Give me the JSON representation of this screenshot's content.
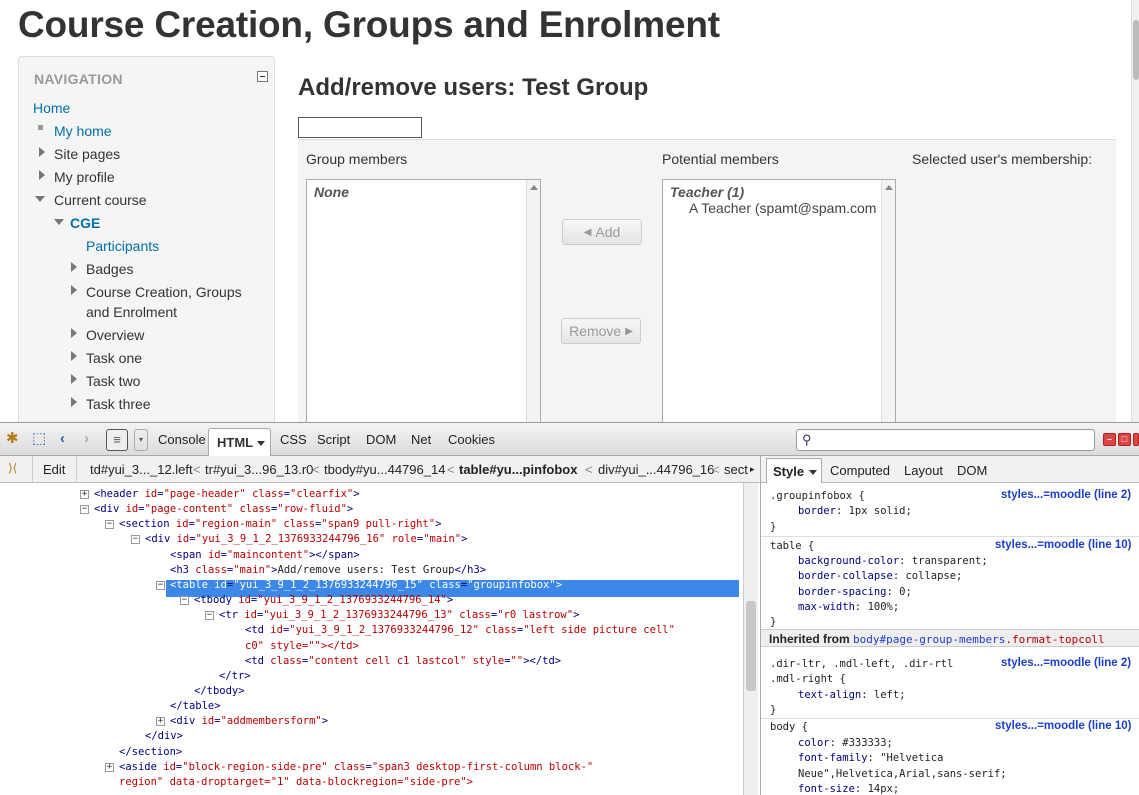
{
  "page": {
    "title": "Course Creation, Groups and Enrolment"
  },
  "navigation": {
    "heading": "NAVIGATION",
    "items": [
      {
        "label": "Home"
      },
      {
        "label": "My home"
      },
      {
        "label": "Site pages"
      },
      {
        "label": "My profile"
      },
      {
        "label": "Current course"
      },
      {
        "label": "CGE"
      },
      {
        "label": "Participants"
      },
      {
        "label": "Badges"
      },
      {
        "label": "Course Creation, Groups"
      },
      {
        "label": "and Enrolment"
      },
      {
        "label": "Overview"
      },
      {
        "label": "Task one"
      },
      {
        "label": "Task two"
      },
      {
        "label": "Task three"
      }
    ]
  },
  "main": {
    "heading": "Add/remove users: Test Group",
    "group_members_label": "Group members",
    "group_members_none": "None",
    "potential_members_label": "Potential members",
    "potential_group": "Teacher (1)",
    "potential_user": "A Teacher (spamt@spam.com",
    "membership_label": "Selected user's membership:",
    "add_label": "Add",
    "remove_label": "Remove",
    "add_icon": "◀",
    "remove_icon": "▶"
  },
  "firebug": {
    "tabs": [
      "Console",
      "HTML",
      "CSS",
      "Script",
      "DOM",
      "Net",
      "Cookies"
    ],
    "edit_label": "Edit",
    "breadcrumbs": [
      "td#yui_3..._12.left",
      "tr#yui_3...96_13.r0",
      "tbody#yu...44796_14",
      "table#yu...pinfobox",
      "div#yui_...44796_16",
      "sect"
    ],
    "side_tabs": [
      "Style",
      "Computed",
      "Layout",
      "DOM"
    ],
    "tree": [
      {
        "t": "<header ",
        "a": [
          [
            "id",
            "page-header"
          ],
          [
            "class",
            "clearfix"
          ]
        ],
        "e": ">"
      },
      {
        "t": "<div ",
        "a": [
          [
            "id",
            "page-content"
          ],
          [
            "class",
            "row-fluid"
          ]
        ],
        "e": ">"
      },
      {
        "t": "<section ",
        "a": [
          [
            "id",
            "region-main"
          ],
          [
            "class",
            "span9 pull-right"
          ]
        ],
        "e": ">"
      },
      {
        "t": "<div ",
        "a": [
          [
            "id",
            "yui_3_9_1_2_1376933244796_16"
          ],
          [
            "role",
            "main"
          ]
        ],
        "e": ">"
      },
      {
        "t": "<span ",
        "a": [
          [
            "id",
            "maincontent"
          ]
        ],
        "e": "></span>"
      },
      {
        "t": "<h3 ",
        "a": [
          [
            "class",
            "main"
          ]
        ],
        "e": ">",
        "x": "Add/remove users: Test Group",
        "c": "</h3>"
      },
      {
        "t": "<table ",
        "a": [
          [
            "id",
            "yui_3_9_1_2_1376933244796_15"
          ],
          [
            "class",
            "groupinfobox"
          ]
        ],
        "e": ">"
      },
      {
        "t": "<tbody ",
        "a": [
          [
            "id",
            "yui_3_9_1_2_1376933244796_14"
          ]
        ],
        "e": ">"
      },
      {
        "t": "<tr ",
        "a": [
          [
            "id",
            "yui_3_9_1_2_1376933244796_13"
          ],
          [
            "class",
            "r0 lastrow"
          ]
        ],
        "e": ">"
      },
      {
        "t": "<td ",
        "a": [
          [
            "id",
            "yui_3_9_1_2_1376933244796_12"
          ],
          [
            "class",
            "left side picture cell"
          ]
        ],
        "e": ""
      },
      {
        "t": "",
        "a": [],
        "e": "",
        "raw": "c0\" style=\"\"></td>"
      },
      {
        "t": "<td ",
        "a": [
          [
            "class",
            "content cell c1 lastcol"
          ],
          [
            "style",
            ""
          ]
        ],
        "e": "></td>"
      },
      {
        "t": "</tr>",
        "a": [],
        "e": ""
      },
      {
        "t": "</tbody>",
        "a": [],
        "e": ""
      },
      {
        "t": "</table>",
        "a": [],
        "e": ""
      },
      {
        "t": "<div ",
        "a": [
          [
            "id",
            "addmembersform"
          ]
        ],
        "e": ">"
      },
      {
        "t": "</div>",
        "a": [],
        "e": ""
      },
      {
        "t": "</section>",
        "a": [],
        "e": ""
      },
      {
        "t": "<aside ",
        "a": [
          [
            "id",
            "block-region-side-pre"
          ],
          [
            "class",
            "span3 desktop-first-column block-"
          ]
        ],
        "e": ""
      },
      {
        "t": "",
        "a": [],
        "e": "",
        "raw": "region\" data-droptarget=\"1\" data-blockregion=\"side-pre\">"
      }
    ],
    "css": {
      "rule1_selector": ".groupinfobox {",
      "rule1_source": "styles...=moodle (line 2)",
      "rule1_props": [
        [
          "border",
          "1px solid;"
        ]
      ],
      "rule2_selector": "table {",
      "rule2_source": "styles...=moodle (line 10)",
      "rule2_props": [
        [
          "background-color",
          "transparent;"
        ],
        [
          "border-collapse",
          "collapse;"
        ],
        [
          "border-spacing",
          "0;"
        ],
        [
          "max-width",
          "100%;"
        ]
      ],
      "inherited_prefix": "Inherited from",
      "inherited_sel": "body#page-group-members",
      "inherited_sel2": ".format-topcoll",
      "rule3_selector": ".dir-ltr, .mdl-left, .dir-rtl",
      "rule3_selector2": ".mdl-right {",
      "rule3_source": "styles...=moodle (line 2)",
      "rule3_props": [
        [
          "text-align",
          "left;"
        ]
      ],
      "rule4_selector": "body {",
      "rule4_source": "styles...=moodle (line 10)",
      "rule4_props": [
        [
          "color",
          "#333333;"
        ],
        [
          "font-family",
          "\"Helvetica"
        ],
        [
          "",
          "Neue\",Helvetica,Arial,sans-serif;"
        ],
        [
          "font-size",
          "14px;"
        ]
      ],
      "close": "}"
    }
  }
}
